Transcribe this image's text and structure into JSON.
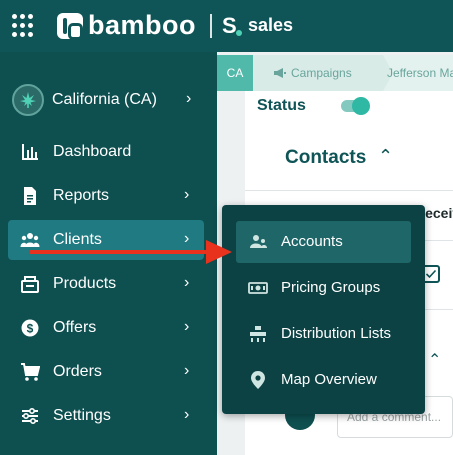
{
  "header": {
    "brand": "bamboo",
    "app_label": "sales",
    "app_mark": "S"
  },
  "sidebar": {
    "state_selector": "California (CA)",
    "items": [
      {
        "label": "Dashboard",
        "icon": "bar-chart-icon",
        "has_chevron": false
      },
      {
        "label": "Reports",
        "icon": "document-icon",
        "has_chevron": true
      },
      {
        "label": "Clients",
        "icon": "group-icon",
        "has_chevron": true,
        "active": true
      },
      {
        "label": "Products",
        "icon": "package-icon",
        "has_chevron": true
      },
      {
        "label": "Offers",
        "icon": "offer-badge-icon",
        "has_chevron": true
      },
      {
        "label": "Orders",
        "icon": "cart-icon",
        "has_chevron": true
      },
      {
        "label": "Settings",
        "icon": "sliders-icon",
        "has_chevron": true
      }
    ]
  },
  "clients_menu": {
    "items": [
      {
        "label": "Accounts",
        "icon": "accounts-icon",
        "active": true
      },
      {
        "label": "Pricing Groups",
        "icon": "money-icon"
      },
      {
        "label": "Distribution Lists",
        "icon": "distribution-icon"
      },
      {
        "label": "Map Overview",
        "icon": "map-pin-icon"
      }
    ]
  },
  "breadcrumb": {
    "state": "CA",
    "campaigns": "Campaigns",
    "current": "Jefferson Ma"
  },
  "main": {
    "status_label": "Status",
    "status_on": true,
    "contacts_heading": "Contacts",
    "column_header": "Receiv",
    "comment_placeholder": "Add a comment..."
  },
  "colors": {
    "sidebar_bg": "#0e4f50",
    "active_item": "#1f7a82",
    "accent": "#2fb8a4",
    "annotation_arrow": "#e8321e"
  }
}
